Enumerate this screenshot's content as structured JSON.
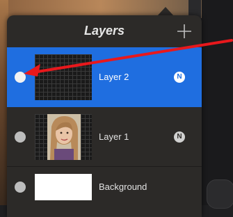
{
  "panel": {
    "title": "Layers",
    "add_icon": "plus-icon"
  },
  "layers": [
    {
      "name": "Layer 2",
      "blend_mode": "N",
      "visible": true,
      "selected": true,
      "thumbnail": "empty-grid"
    },
    {
      "name": "Layer 1",
      "blend_mode": "N",
      "visible": true,
      "selected": false,
      "thumbnail": "portrait-photo"
    },
    {
      "name": "Background",
      "blend_mode": "",
      "visible": true,
      "selected": false,
      "thumbnail": "white-fill"
    }
  ],
  "colors": {
    "selected_row": "#1f6ee0",
    "panel_bg": "#2c2a28",
    "annotation_arrow": "#e8181c"
  }
}
